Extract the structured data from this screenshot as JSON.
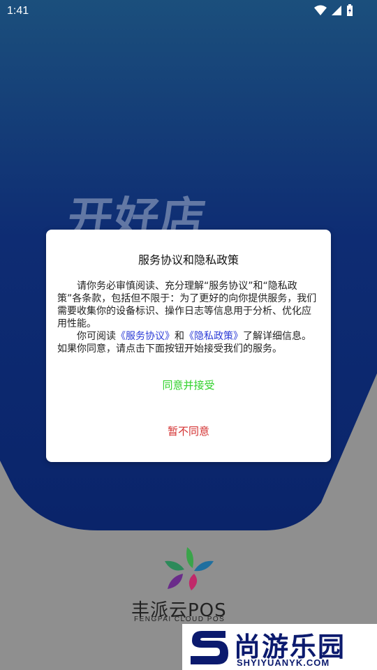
{
  "status_bar": {
    "time": "1:41"
  },
  "background": {
    "brand_text": "开好店"
  },
  "dialog": {
    "title": "服务协议和隐私政策",
    "paragraph1": "请你务必审慎阅读、充分理解“服务协议”和“隐私政策”各条款，包括但不限于：为了更好的向你提供服务，我们需要收集你的设备标识、操作日志等信息用于分析、优化应用性能。",
    "p2_prefix": "你可阅读",
    "p2_link1": "《服务协议》",
    "p2_mid": "和",
    "p2_link2": "《隐私政策》",
    "p2_suffix": "了解详细信息。如果你同意，请点击下面按钮开始接受我们的服务。",
    "accept_label": "同意并接受",
    "decline_label": "暂不同意"
  },
  "logo": {
    "name": "丰派云POS",
    "sub": "FENGPAI CLOUD POS"
  },
  "watermark": {
    "title": "尚游乐园",
    "url": "SHYIYUANYK.COM"
  },
  "colors": {
    "accept": "#2fd12a",
    "decline": "#d32f2f",
    "link": "#2b3bd6",
    "bg_dark": "#0f2f7a"
  }
}
